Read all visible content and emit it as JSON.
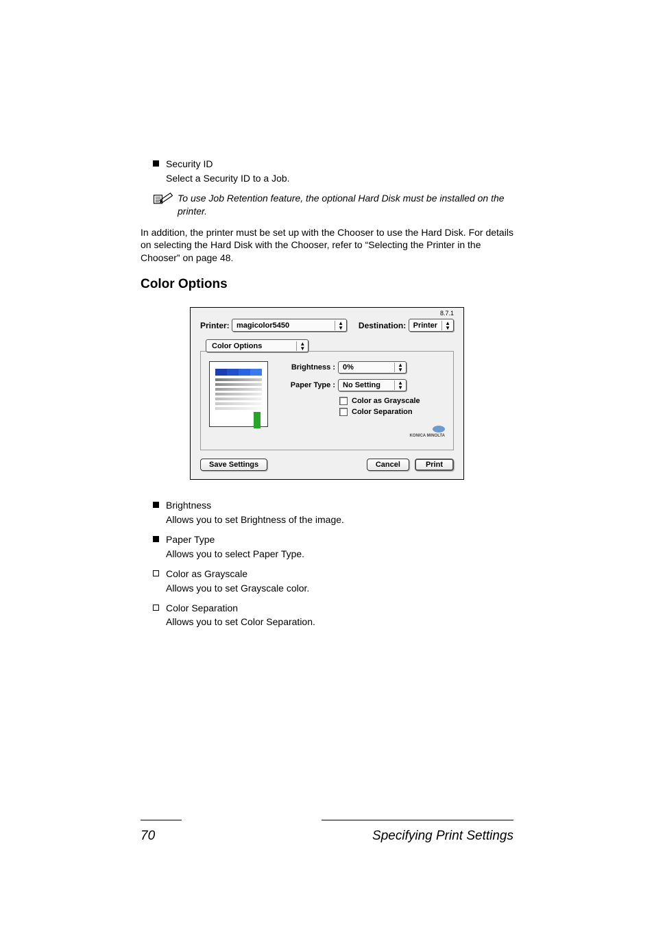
{
  "list1": {
    "item1_label": "Security ID",
    "item1_desc": "Select a Security ID to a Job."
  },
  "note": "To use Job Retention feature, the optional Hard Disk must be installed on the printer.",
  "para1": "In addition, the printer must be set up with the Chooser to use the Hard Disk. For details on selecting the Hard Disk with the Chooser, refer to “Selecting the Printer in the Chooser” on page 48.",
  "section_title": "Color Options",
  "dialog": {
    "version": "8.7.1",
    "printer_label": "Printer:",
    "printer_value": "magicolor5450",
    "destination_label": "Destination:",
    "destination_value": "Printer",
    "panel_value": "Color Options",
    "brightness_label": "Brightness :",
    "brightness_value": "0%",
    "papertype_label": "Paper Type :",
    "papertype_value": "No Setting",
    "chk1": "Color as Grayscale",
    "chk2": "Color Separation",
    "logo_text": "KONICA MINOLTA",
    "save_btn": "Save Settings",
    "cancel_btn": "Cancel",
    "print_btn": "Print"
  },
  "list2": [
    {
      "title": "Brightness",
      "desc": "Allows you to set Brightness of the image."
    },
    {
      "title": "Paper Type",
      "desc": "Allows you to select Paper Type."
    },
    {
      "title": "Color as Grayscale",
      "desc": "Allows you to set Grayscale color."
    },
    {
      "title": "Color Separation",
      "desc": "Allows you to set Color Separation."
    }
  ],
  "footer": {
    "page": "70",
    "title": "Specifying Print Settings"
  }
}
